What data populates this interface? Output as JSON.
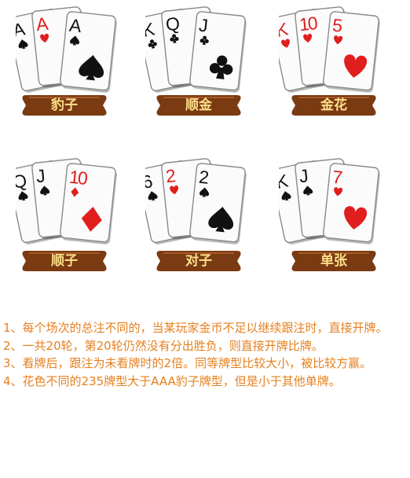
{
  "hands": [
    {
      "label": "豹子",
      "cards": [
        {
          "rank": "A",
          "suit": "spade",
          "color": "#111111"
        },
        {
          "rank": "A",
          "suit": "heart",
          "color": "#e01e1e"
        },
        {
          "rank": "A",
          "suit": "spade",
          "color": "#111111"
        }
      ]
    },
    {
      "label": "顺金",
      "cards": [
        {
          "rank": "K",
          "suit": "club",
          "color": "#111111"
        },
        {
          "rank": "Q",
          "suit": "club",
          "color": "#111111"
        },
        {
          "rank": "J",
          "suit": "club",
          "color": "#111111"
        }
      ]
    },
    {
      "label": "金花",
      "cards": [
        {
          "rank": "K",
          "suit": "heart",
          "color": "#e01e1e"
        },
        {
          "rank": "10",
          "suit": "heart",
          "color": "#e01e1e"
        },
        {
          "rank": "5",
          "suit": "heart",
          "color": "#e01e1e"
        }
      ]
    },
    {
      "label": "顺子",
      "cards": [
        {
          "rank": "Q",
          "suit": "spade",
          "color": "#111111"
        },
        {
          "rank": "J",
          "suit": "spade",
          "color": "#111111"
        },
        {
          "rank": "10",
          "suit": "diamond",
          "color": "#e01e1e"
        }
      ]
    },
    {
      "label": "对子",
      "cards": [
        {
          "rank": "6",
          "suit": "spade",
          "color": "#111111"
        },
        {
          "rank": "2",
          "suit": "heart",
          "color": "#e01e1e"
        },
        {
          "rank": "2",
          "suit": "spade",
          "color": "#111111"
        }
      ]
    },
    {
      "label": "单张",
      "cards": [
        {
          "rank": "K",
          "suit": "spade",
          "color": "#111111"
        },
        {
          "rank": "J",
          "suit": "spade",
          "color": "#111111"
        },
        {
          "rank": "7",
          "suit": "heart",
          "color": "#e01e1e"
        }
      ]
    }
  ],
  "rules": [
    {
      "num": "1、",
      "text": "每个场次的总注不同的，当某玩家金币不足以继续跟注时，直接开牌。"
    },
    {
      "num": "2、",
      "text": "一共20轮，第20轮仍然没有分出胜负，则直接开牌比牌。"
    },
    {
      "num": "3、",
      "text": "看牌后，跟注为未看牌时的2倍。同等牌型比较大小，被比较方赢。"
    },
    {
      "num": "4、",
      "text": "花色不同的235牌型大于AAA豹子牌型，但是小于其他单牌。"
    }
  ],
  "colors": {
    "label_bg": "#7a3a12",
    "label_text": "#ffe08a",
    "rule_text": "#e6801e",
    "red_suit": "#e01e1e",
    "black_suit": "#111111"
  }
}
